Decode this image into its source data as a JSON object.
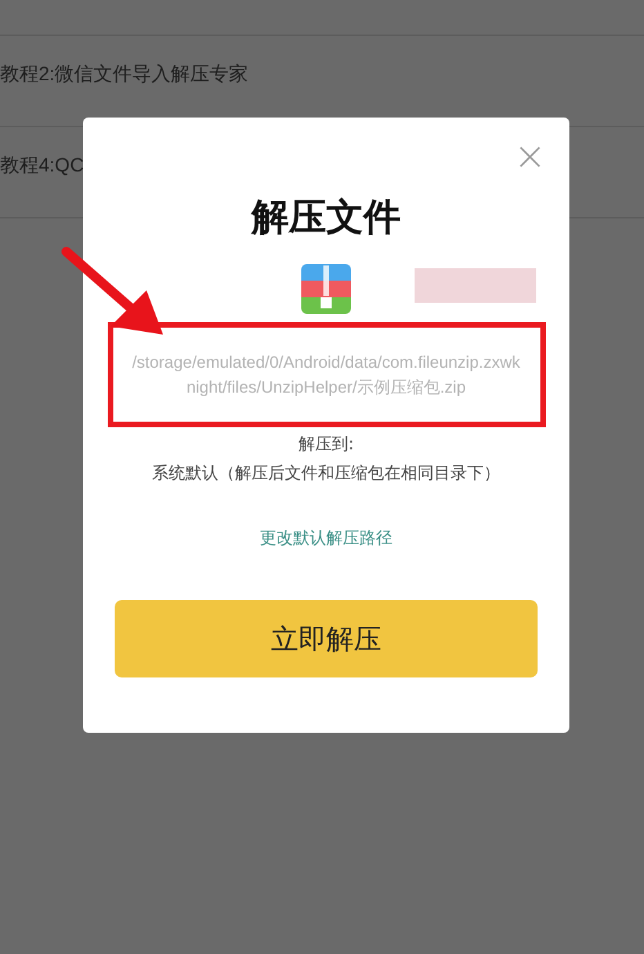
{
  "background_list": [
    {
      "title": "教程2:微信文件导入解压专家"
    },
    {
      "title": "教程4:QC"
    }
  ],
  "dialog": {
    "title": "解压文件",
    "file_path": "/storage/emulated/0/Android/data/com.fileunzip.zxwknight/files/UnzipHelper/示例压缩包.zip",
    "extract_to_label": "解压到:",
    "extract_to_value": "系统默认（解压后文件和压缩包在相同目录下）",
    "change_path_link": "更改默认解压路径",
    "confirm_button": "立即解压"
  }
}
